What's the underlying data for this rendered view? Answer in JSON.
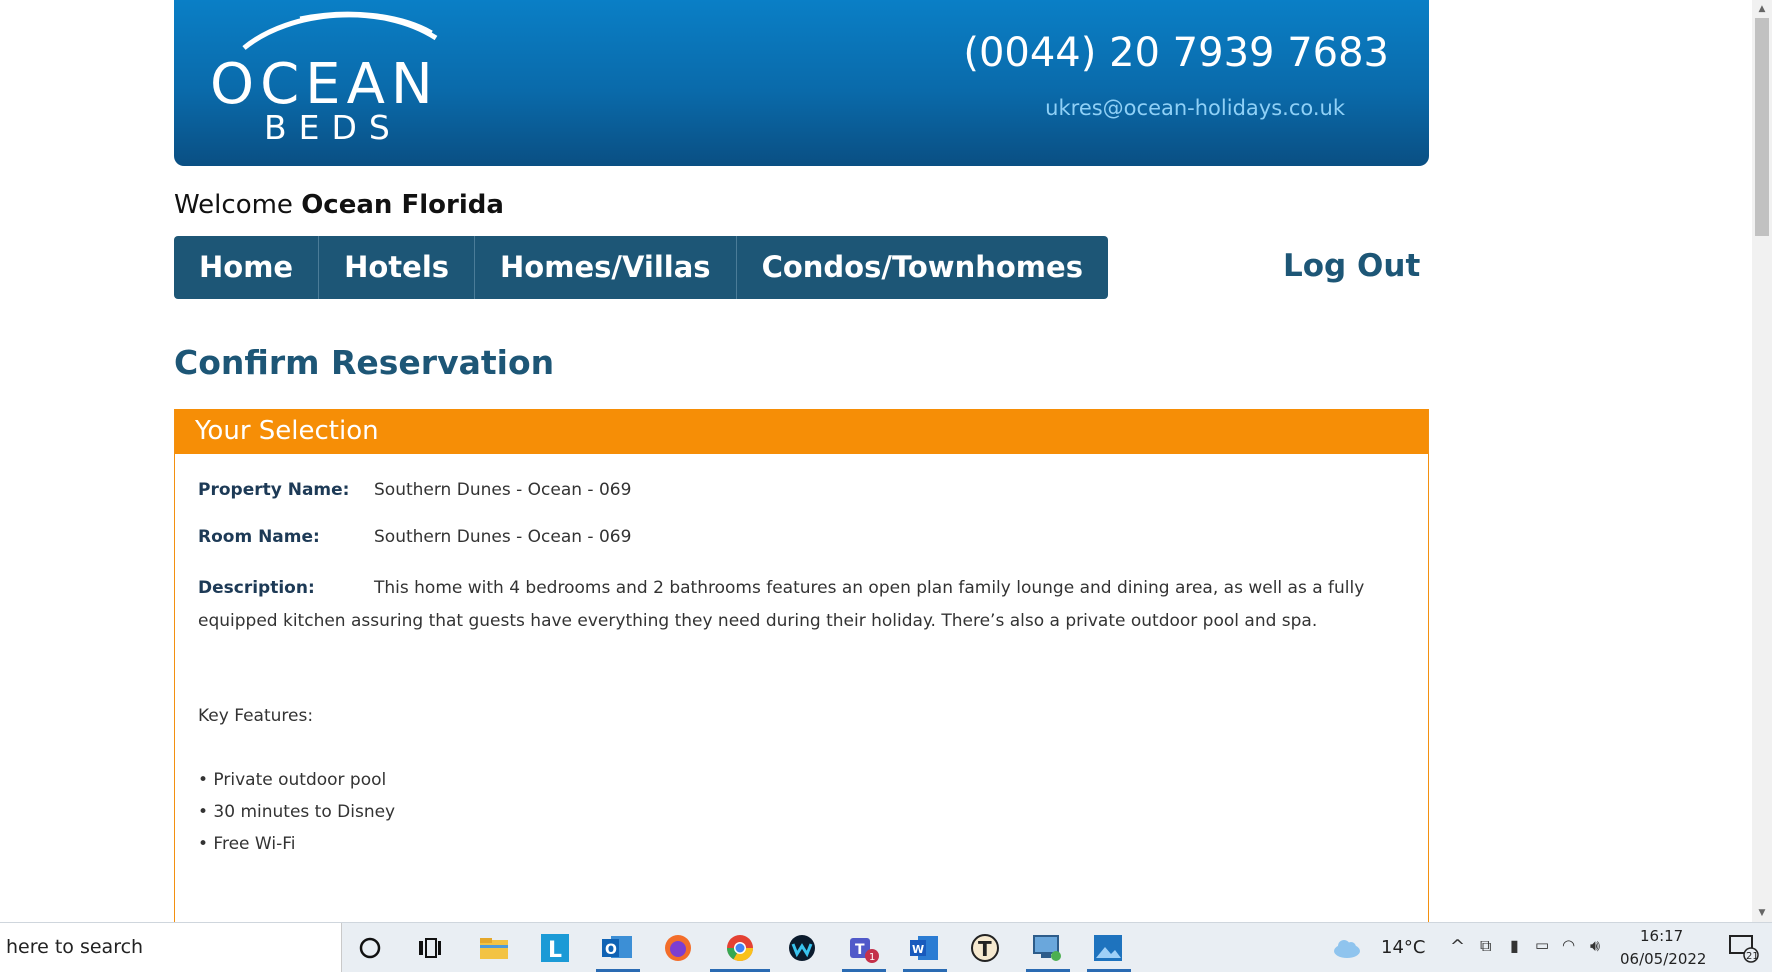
{
  "header": {
    "logo_line1": "OCEAN",
    "logo_line2": "BEDS",
    "phone": "(0044) 20 7939 7683",
    "email": "ukres@ocean-holidays.co.uk"
  },
  "welcome": {
    "prefix": "Welcome",
    "user": "Ocean Florida"
  },
  "nav": {
    "items": [
      {
        "label": "Home"
      },
      {
        "label": "Hotels"
      },
      {
        "label": "Homes/Villas"
      },
      {
        "label": "Condos/Townhomes"
      }
    ],
    "logout": "Log Out"
  },
  "page_title": "Confirm Reservation",
  "selection": {
    "heading": "Your Selection",
    "property_label": "Property Name:",
    "property_value": "Southern Dunes - Ocean - 069",
    "room_label": "Room Name:",
    "room_value": "Southern Dunes - Ocean - 069",
    "description_label": "Description:",
    "description_value": "This home with 4 bedrooms and 2 bathrooms features an open plan family lounge and dining area, as well as a fully equipped kitchen assuring that guests have everything they need during their holiday. There’s also a private outdoor pool and spa.",
    "key_features_title": "Key Features:",
    "features": [
      "• Private outdoor pool",
      "• 30 minutes to Disney",
      "• Free Wi-Fi"
    ]
  },
  "taskbar": {
    "search_text": "here to search",
    "temperature": "14°C",
    "time": "16:17",
    "date": "06/05/2022",
    "notifications": "21",
    "teams_badge": "1",
    "apps": [
      "cortana-icon",
      "task-view-icon",
      "file-explorer-icon",
      "l-app-icon",
      "outlook-icon",
      "firefox-icon",
      "chrome-icon",
      "webex-icon",
      "teams-icon",
      "word-icon",
      "t-app-icon",
      "remote-desktop-icon",
      "photos-icon"
    ]
  },
  "colors": {
    "brand_blue": "#1d5676",
    "header_blue": "#0a6aaa",
    "accent_orange": "#f68e06"
  }
}
